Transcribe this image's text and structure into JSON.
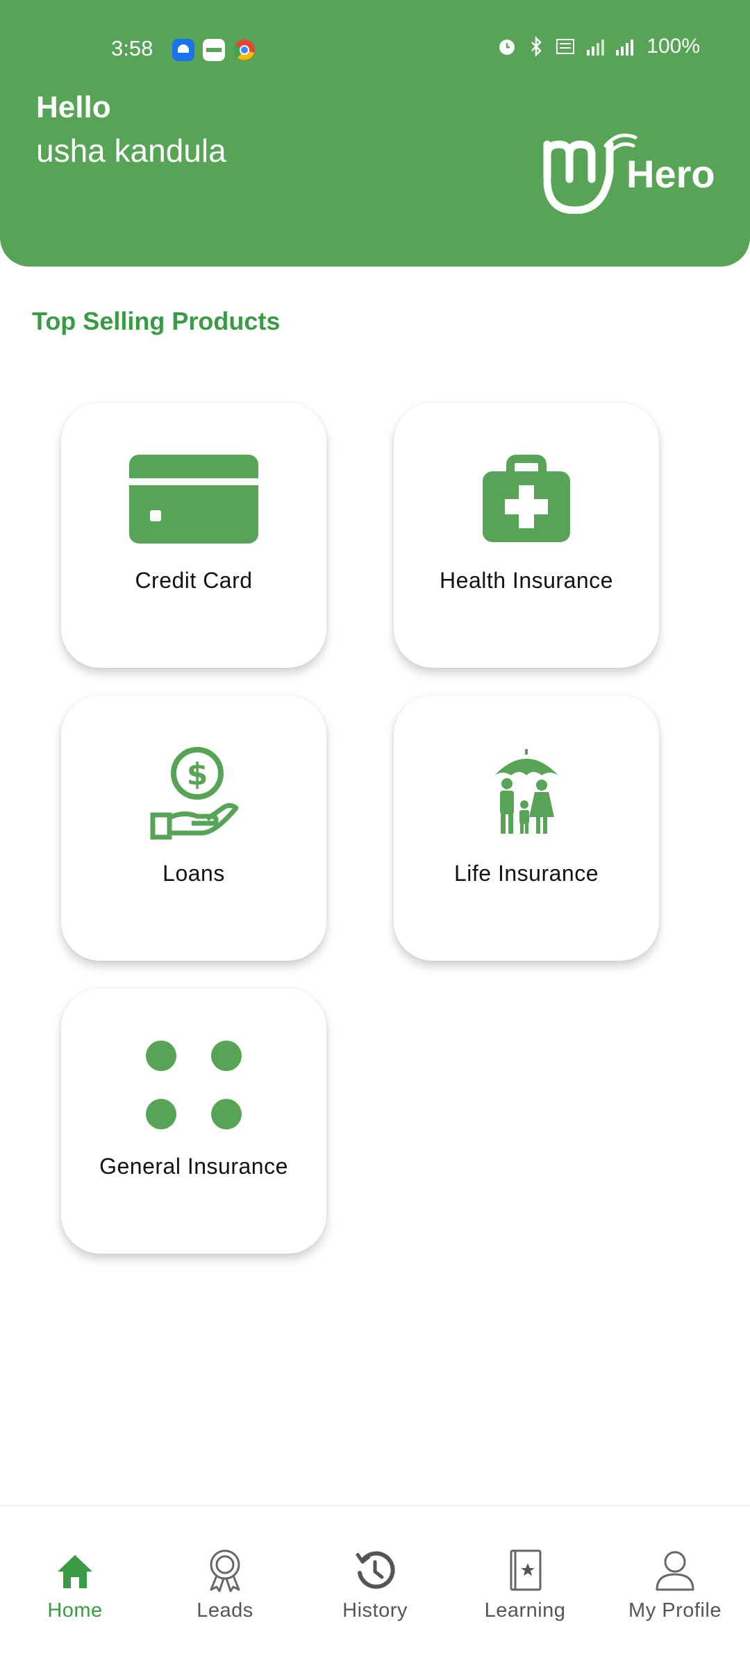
{
  "status_bar": {
    "time": "3:58",
    "battery": "100%",
    "icons": [
      "app-notification-icon",
      "app-notification-icon",
      "chrome-icon",
      "alarm-icon",
      "bluetooth-icon",
      "volte-icon",
      "signal-4g-icon",
      "signal-icon"
    ]
  },
  "header": {
    "greeting": "Hello",
    "username": "usha kandula",
    "logo_text": "Hero",
    "background_color": "#57a456"
  },
  "main": {
    "section_title": "Top Selling Products",
    "products": [
      {
        "label": "Credit Card",
        "icon": "credit-card-icon"
      },
      {
        "label": "Health Insurance",
        "icon": "medical-kit-icon"
      },
      {
        "label": "Loans",
        "icon": "money-hand-icon"
      },
      {
        "label": "Life Insurance",
        "icon": "family-umbrella-icon"
      },
      {
        "label": "General Insurance",
        "icon": "grid-dots-icon"
      }
    ]
  },
  "bottom_nav": {
    "items": [
      {
        "label": "Home",
        "icon": "home-icon",
        "active": true
      },
      {
        "label": "Leads",
        "icon": "award-icon",
        "active": false
      },
      {
        "label": "History",
        "icon": "history-icon",
        "active": false
      },
      {
        "label": "Learning",
        "icon": "book-icon",
        "active": false
      },
      {
        "label": "My Profile",
        "icon": "user-icon",
        "active": false
      }
    ]
  },
  "colors": {
    "accent": "#57a456",
    "title_green": "#3a9b45",
    "inactive_nav": "#555555"
  }
}
